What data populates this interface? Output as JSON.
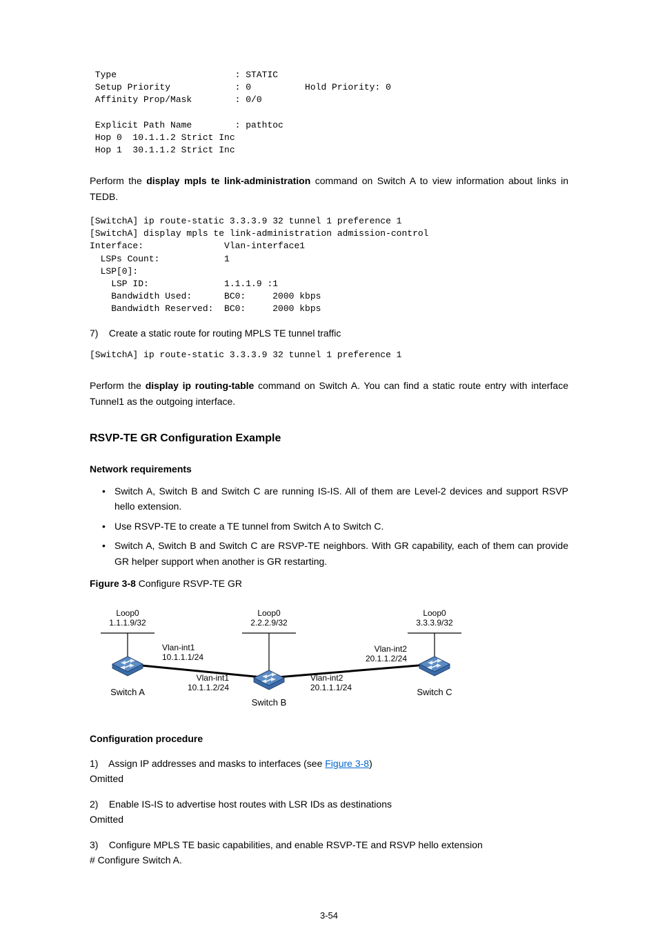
{
  "pre1": " Type                      : STATIC \n Setup Priority            : 0          Hold Priority: 0 \n Affinity Prop/Mask        : 0/0 \n \n Explicit Path Name        : pathtoc \n Hop 0  10.1.1.2 Strict Inc \n Hop 1  30.1.1.2 Strict Inc",
  "para1": {
    "before_bold": "Perform the ",
    "bold": "display mpls te link-administration",
    "after_bold": " command on Switch A to view information about links in TEDB."
  },
  "pre2": "[SwitchA] ip route-static 3.3.3.9 32 tunnel 1 preference 1 \n[SwitchA] display mpls te link-administration admission-control \nInterface:               Vlan-interface1 \n  LSPs Count:            1 \n  LSP[0]: \n    LSP ID:              1.1.1.9 :1 \n    Bandwidth Used:      BC0:     2000 kbps \n    Bandwidth Reserved:  BC0:     2000 kbps",
  "step7_num": "7)",
  "step7_text": "Create a static route for routing MPLS TE tunnel traffic",
  "pre3": "[SwitchA] ip route-static 3.3.3.9 32 tunnel 1 preference 1",
  "para2": {
    "before_bold": "Perform the ",
    "bold": "display ip routing-table",
    "after_bold": " command on Switch A. You can find a static route entry with interface Tunnel1 as the outgoing interface."
  },
  "heading_main": "RSVP-TE GR Configuration Example",
  "heading_netreq": "Network requirements",
  "bullets": [
    "Switch A, Switch B and Switch C are running IS-IS. All of them are Level-2 devices and support RSVP hello extension.",
    "Use RSVP-TE to create a TE tunnel from Switch A to Switch C.",
    "Switch A, Switch B and Switch C are RSVP-TE neighbors. With GR capability, each of them can provide GR helper support when another is GR restarting."
  ],
  "figure": {
    "label": "Figure 3-8",
    "title": "Configure RSVP-TE GR"
  },
  "diagram": {
    "nodes": {
      "a": {
        "name": "Switch A",
        "loop": "Loop0",
        "loop_ip": "1.1.1.9/32",
        "if": "Vlan-int1",
        "if_ip": "10.1.1.1/24"
      },
      "b": {
        "name": "Switch B",
        "loop": "Loop0",
        "loop_ip": "2.2.2.9/32",
        "if_left": "Vlan-int1",
        "if_left_ip": "10.1.1.2/24",
        "if_right": "Vlan-int2",
        "if_right_ip": "20.1.1.1/24"
      },
      "c": {
        "name": "Switch C",
        "loop": "Loop0",
        "loop_ip": "3.3.3.9/32",
        "if": "Vlan-int2",
        "if_ip": "20.1.1.2/24"
      }
    }
  },
  "heading_cfg": "Configuration procedure",
  "steps": {
    "s1_num": "1)",
    "s1_text_before": "Assign IP addresses and masks to interfaces (see ",
    "s1_link": "Figure 3-8",
    "s1_text_after": ")",
    "omitted": "Omitted",
    "s2_num": "2)",
    "s2_text": "Enable IS-IS to advertise host routes with LSR IDs as destinations",
    "s3_num": "3)",
    "s3_text": "Configure MPLS TE basic capabilities, and enable RSVP-TE and RSVP hello extension",
    "s3_note": "# Configure Switch A."
  },
  "page_number": "3-54"
}
